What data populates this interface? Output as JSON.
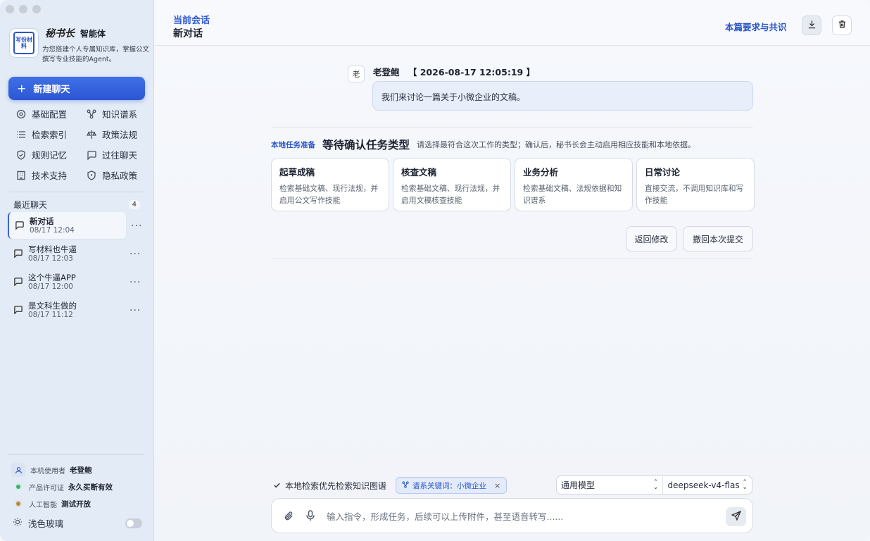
{
  "sidebar": {
    "brand": {
      "logo_text": "写份材料",
      "script_name": "秘书长",
      "name": "智能体",
      "description": "为您搭建个人专属知识库，掌握公文撰写专业技能的Agent。"
    },
    "new_chat_label": "新建聊天",
    "menu": [
      {
        "label": "基础配置",
        "icon": "gear-icon"
      },
      {
        "label": "知识谱系",
        "icon": "graph-icon"
      },
      {
        "label": "检索索引",
        "icon": "list-icon"
      },
      {
        "label": "政策法规",
        "icon": "policy-icon"
      },
      {
        "label": "规则记忆",
        "icon": "shield-check-icon"
      },
      {
        "label": "过往聊天",
        "icon": "chat-icon"
      },
      {
        "label": "技术支持",
        "icon": "building-icon"
      },
      {
        "label": "隐私政策",
        "icon": "shield-icon"
      }
    ],
    "recent": {
      "title": "最近聊天",
      "count": "4",
      "items": [
        {
          "name": "新对话",
          "date": "08/17 12:04"
        },
        {
          "name": "写材料也牛逼",
          "date": "08/17 12:03"
        },
        {
          "name": "这个牛逼APP",
          "date": "08/17 12:00"
        },
        {
          "name": "是文科生做的",
          "date": "08/17 11:12"
        }
      ],
      "more": "···"
    },
    "footer": {
      "user_key": "本机使用者",
      "user_val": "老登鲍",
      "license_key": "产品许可证",
      "license_val": "永久买断有效",
      "ai_key": "人工智能",
      "ai_val": "测试开放",
      "license_dot_color": "#3bb273",
      "ai_dot_color": "#b0884a"
    },
    "theme_label": "浅色玻璃"
  },
  "main": {
    "session_label": "当前会话",
    "session_title": "新对话",
    "requirements_link": "本篇要求与共识",
    "message": {
      "avatar": "老",
      "author": "老登鲍",
      "timestamp": "【 2026-08-17 12:05:19 】",
      "text": "我们来讨论一篇关于小微企业的文稿。"
    },
    "task": {
      "tag": "本地任务准备",
      "title": "等待确认任务类型",
      "desc": "请选择最符合这次工作的类型；确认后，秘书长会主动启用相应技能和本地依据。",
      "cards": [
        {
          "title": "起草成稿",
          "desc": "检索基础文稿、现行法规，并启用公文写作技能"
        },
        {
          "title": "核查文稿",
          "desc": "检索基础文稿、现行法规，并启用文稿核查技能"
        },
        {
          "title": "业务分析",
          "desc": "检索基础文稿、法规依据和知识谱系"
        },
        {
          "title": "日常讨论",
          "desc": "直接交流，不调用知识库和写作技能"
        }
      ],
      "back_label": "返回修改",
      "revoke_label": "撤回本次提交"
    },
    "options": {
      "check_label": "本地检索优先检索知识图谱",
      "chip_label": "谱系关键词：小微企业",
      "chip_close": "×",
      "model_type": "通用模型",
      "model_name": "deepseek-v4-flas"
    },
    "input_placeholder": "输入指令，形成任务，后续可以上传附件，甚至语音转写......"
  },
  "colors": {
    "accent": "#2c57d4",
    "sidebar_bg": "#e3ebf6"
  }
}
